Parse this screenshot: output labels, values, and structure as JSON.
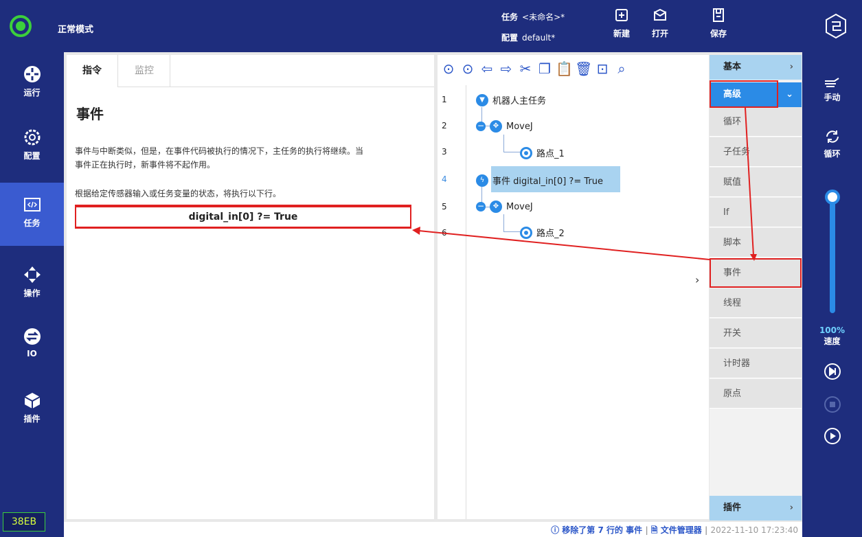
{
  "topbar": {
    "mode": "正常模式",
    "task_label": "任务",
    "task_value": "<未命名>*",
    "config_label": "配置",
    "config_value": "default*",
    "new_label": "新建",
    "open_label": "打开",
    "save_label": "保存"
  },
  "leftnav": {
    "items": [
      {
        "label": "运行",
        "icon": "run-icon"
      },
      {
        "label": "配置",
        "icon": "config-gear-icon"
      },
      {
        "label": "任务",
        "icon": "code-task-icon",
        "active": true
      },
      {
        "label": "操作",
        "icon": "move-arrows-icon"
      },
      {
        "label": "IO",
        "icon": "io-icon"
      },
      {
        "label": "插件",
        "icon": "cube-plugin-icon"
      }
    ],
    "code": "38EB"
  },
  "left_panel": {
    "tabs": [
      "指令",
      "监控"
    ],
    "title": "事件",
    "desc1": "事件与中断类似，但是，在事件代码被执行的情况下，主任务的执行将继续。当",
    "desc2": "事件正在执行时，新事件将不起作用。",
    "desc3": "根据给定传感器输入或任务变量的状态，将执行以下行。",
    "condition": "digital_in[0] ?= True"
  },
  "tree": {
    "lines": [
      "1",
      "2",
      "3",
      "4",
      "5",
      "6"
    ],
    "nodes": {
      "main": "机器人主任务",
      "movej1": "MoveJ",
      "waypoint1": "路点_1",
      "event": "事件 digital_in[0] ?= True",
      "movej2": "MoveJ",
      "waypoint2": "路点_2"
    }
  },
  "palette": {
    "basic": "基本",
    "advanced": "高级",
    "items": [
      "循环",
      "子任务",
      "赋值",
      "If",
      "脚本",
      "事件",
      "线程",
      "开关",
      "计时器",
      "原点"
    ],
    "plugins": "插件"
  },
  "rightrail": {
    "manual": "手动",
    "loop": "循环",
    "speed_pct": "100%",
    "speed_label": "速度"
  },
  "status": {
    "message": "移除了第 7 行的 事件",
    "file_manager": "文件管理器",
    "timestamp": "2022-11-10 17:23:40"
  },
  "colors": {
    "brand_navy": "#1e2d7d",
    "accent_blue": "#2b8be6",
    "highlight_red": "#e02020",
    "status_green": "#3ccf3c"
  }
}
